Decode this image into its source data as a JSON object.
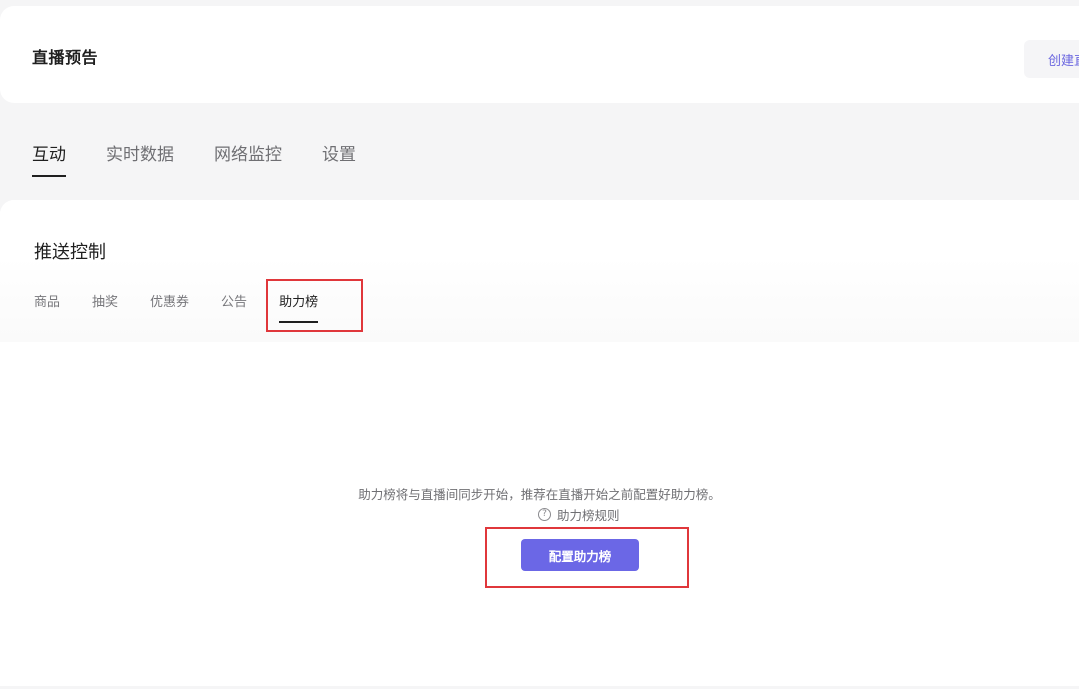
{
  "header": {
    "title": "直播预告",
    "create_button_label": "创建直播"
  },
  "main_tabs": [
    {
      "label": "互动",
      "active": true
    },
    {
      "label": "实时数据",
      "active": false
    },
    {
      "label": "网络监控",
      "active": false
    },
    {
      "label": "设置",
      "active": false
    }
  ],
  "push_control": {
    "title": "推送控制",
    "tabs": [
      {
        "label": "商品",
        "active": false
      },
      {
        "label": "抽奖",
        "active": false
      },
      {
        "label": "优惠券",
        "active": false
      },
      {
        "label": "公告",
        "active": false
      },
      {
        "label": "助力榜",
        "active": true
      }
    ]
  },
  "empty_state": {
    "hint": "助力榜将与直播间同步开始，推荐在直播开始之前配置好助力榜。",
    "rules_icon": "question-circle-icon",
    "rules_link": "助力榜规则",
    "config_button_label": "配置助力榜"
  },
  "colors": {
    "accent": "#6b67e6",
    "highlight": "#e0373b",
    "background": "#f5f5f6"
  }
}
